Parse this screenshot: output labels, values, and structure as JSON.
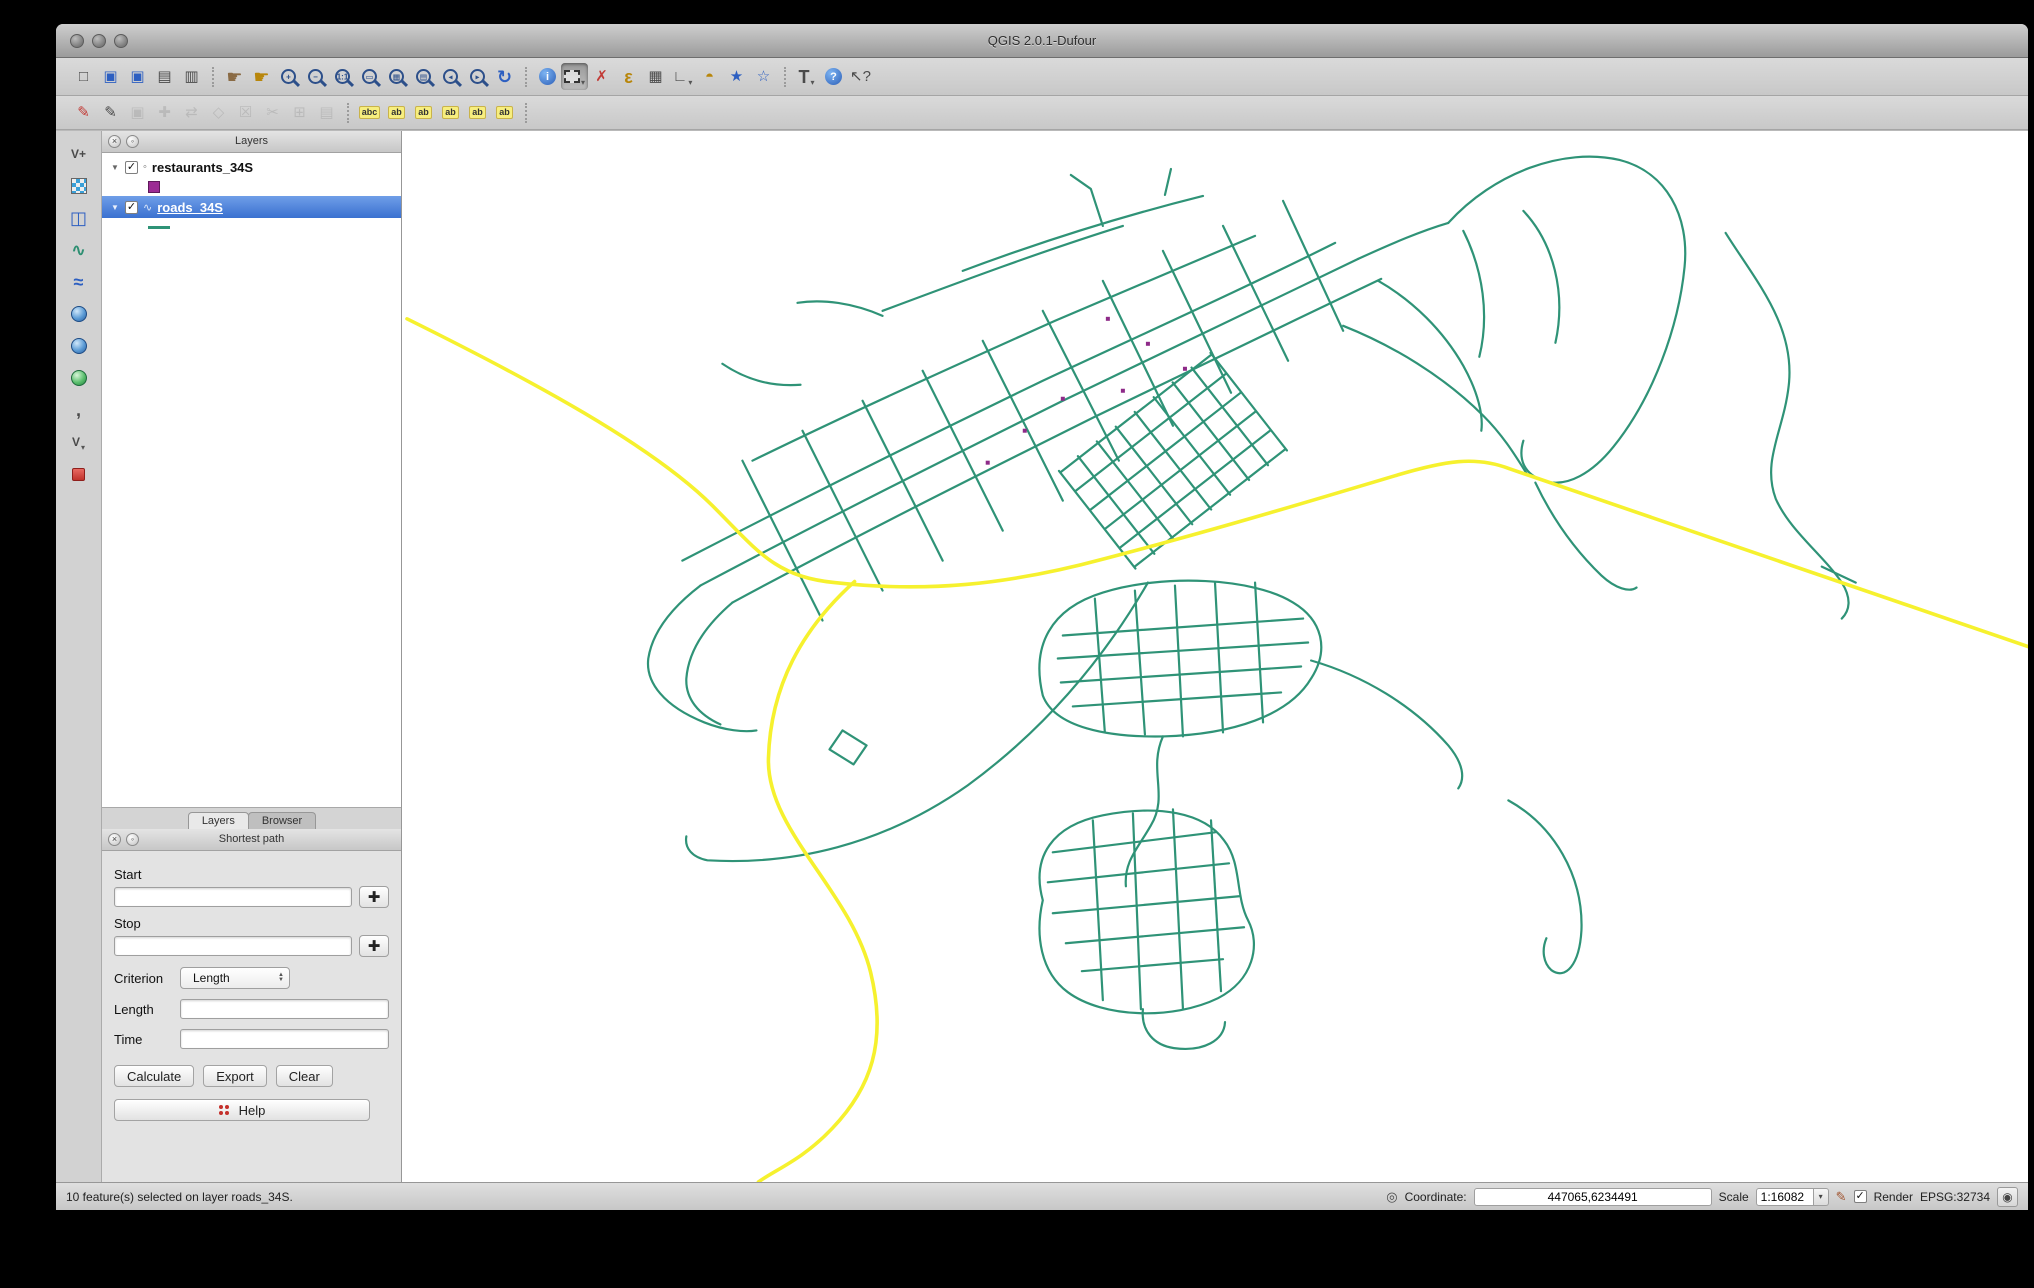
{
  "window": {
    "title": "QGIS 2.0.1-Dufour"
  },
  "ui": {
    "check": "✓",
    "dropdown": "▾",
    "disclosure": "▼",
    "close": "×",
    "float": "◦",
    "capture": "✚",
    "spin_up": "▲",
    "spin_down": "▼"
  },
  "toolbar_row1": {
    "items": [
      {
        "name": "new-project",
        "glyph": "□"
      },
      {
        "name": "save-project",
        "glyph": "▣"
      },
      {
        "name": "save-project-as",
        "glyph": "▣"
      },
      {
        "name": "new-print-composer",
        "glyph": "▤"
      },
      {
        "name": "composer-manager",
        "glyph": "▥"
      },
      {
        "name": "pan-map",
        "glyph": "☛"
      },
      {
        "name": "pan-to-selection",
        "glyph": "☛"
      },
      {
        "name": "zoom-in",
        "glyph": "+"
      },
      {
        "name": "zoom-out",
        "glyph": "−"
      },
      {
        "name": "zoom-native",
        "glyph": "1:1"
      },
      {
        "name": "zoom-full",
        "glyph": "▭"
      },
      {
        "name": "zoom-to-selection",
        "glyph": "▦"
      },
      {
        "name": "zoom-to-layer",
        "glyph": "▤"
      },
      {
        "name": "zoom-last",
        "glyph": "◂"
      },
      {
        "name": "zoom-next",
        "glyph": "▸"
      },
      {
        "name": "refresh",
        "glyph": "↻"
      },
      {
        "name": "identify",
        "glyph": "i"
      },
      {
        "name": "select-features",
        "glyph": "",
        "active": true
      },
      {
        "name": "deselect-features",
        "glyph": "✗"
      },
      {
        "name": "select-by-expression",
        "glyph": "ε"
      },
      {
        "name": "attribute-table",
        "glyph": "▦"
      },
      {
        "name": "measure",
        "glyph": "∟"
      },
      {
        "name": "map-tips",
        "glyph": "◓"
      },
      {
        "name": "new-bookmark",
        "glyph": "★"
      },
      {
        "name": "show-bookmarks",
        "glyph": "☆"
      },
      {
        "name": "text-annotation",
        "glyph": "T"
      },
      {
        "name": "help",
        "glyph": "?"
      },
      {
        "name": "whats-this",
        "glyph": "↖?"
      }
    ]
  },
  "toolbar_row2": {
    "items": [
      {
        "name": "current-edits",
        "glyph": "✎"
      },
      {
        "name": "toggle-editing",
        "glyph": "✎"
      },
      {
        "name": "save-edits",
        "glyph": "▣"
      },
      {
        "name": "add-feature",
        "glyph": "✚"
      },
      {
        "name": "move-feature",
        "glyph": "⇄"
      },
      {
        "name": "node-tool",
        "glyph": "◇"
      },
      {
        "name": "delete-selected",
        "glyph": "☒"
      },
      {
        "name": "cut-features",
        "glyph": "✂"
      },
      {
        "name": "copy-features",
        "glyph": "⊞"
      },
      {
        "name": "paste-features",
        "glyph": "▤"
      },
      {
        "name": "labeling",
        "glyph": "abc"
      },
      {
        "name": "pin-labels",
        "glyph": "ab"
      },
      {
        "name": "highlight-labels",
        "glyph": "ab"
      },
      {
        "name": "move-label",
        "glyph": "ab"
      },
      {
        "name": "rotate-label",
        "glyph": "ab"
      },
      {
        "name": "change-label",
        "glyph": "ab"
      }
    ]
  },
  "layer_toolbar": {
    "items": [
      {
        "name": "add-vector-layer",
        "glyph": "V+"
      },
      {
        "name": "add-raster-layer",
        "glyph": ""
      },
      {
        "name": "add-postgis-layer",
        "glyph": "◫"
      },
      {
        "name": "add-spatialite-layer",
        "glyph": "∿"
      },
      {
        "name": "add-mssql-layer",
        "glyph": "≈"
      },
      {
        "name": "add-wms-layer",
        "glyph": ""
      },
      {
        "name": "add-wcs-layer",
        "glyph": ""
      },
      {
        "name": "add-wfs-layer",
        "glyph": ""
      },
      {
        "name": "add-delimited-text-layer",
        "glyph": ","
      },
      {
        "name": "new-shapefile-layer",
        "glyph": "V"
      },
      {
        "name": "remove-layer",
        "glyph": ""
      }
    ]
  },
  "layers_panel": {
    "title": "Layers",
    "layers": [
      {
        "name": "restaurants_34S",
        "type_glyph": "◦",
        "checked": true
      },
      {
        "name": "roads_34S",
        "type_glyph": "∿",
        "checked": true,
        "selected": true
      }
    ],
    "tabs": [
      {
        "label": "Layers",
        "active": true
      },
      {
        "label": "Browser",
        "active": false
      }
    ]
  },
  "shortest_path": {
    "title": "Shortest path",
    "start_label": "Start",
    "start_value": "",
    "stop_label": "Stop",
    "stop_value": "",
    "criterion_label": "Criterion",
    "criterion_value": "Length",
    "length_label": "Length",
    "length_value": "",
    "time_label": "Time",
    "time_value": "",
    "calculate_label": "Calculate",
    "export_label": "Export",
    "clear_label": "Clear",
    "help_label": "Help"
  },
  "status_bar": {
    "message": "10 feature(s) selected on layer roads_34S.",
    "coordinate_label": "Coordinate:",
    "coordinate_value": "447065,6234491",
    "scale_label": "Scale",
    "scale_value": "1:16082",
    "render_label": "Render",
    "epsg_label": "EPSG:32734"
  },
  "map": {
    "road_color": "#2f9377",
    "selected_color": "#f6f12e",
    "restaurant_color": "#8e2a88",
    "background": "#ffffff"
  }
}
